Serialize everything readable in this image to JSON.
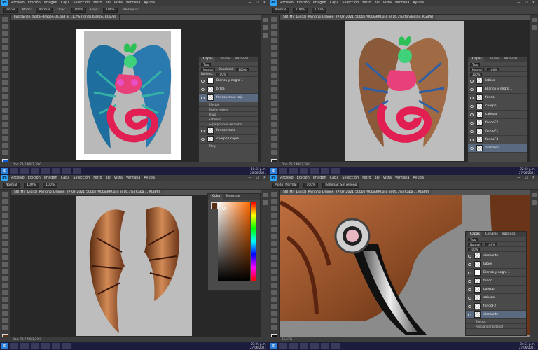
{
  "menu": [
    "Archivo",
    "Edición",
    "Imagen",
    "Capa",
    "Selección",
    "Filtro",
    "3D",
    "Vista",
    "Ventana",
    "Ayuda"
  ],
  "window_controls": [
    "—",
    "☐",
    "✕"
  ],
  "q1": {
    "options": {
      "tool": "Pincel",
      "mode_label": "Modo:",
      "mode": "Normal",
      "opacity_label": "Opac.:",
      "opacity": "100%",
      "flow_label": "Flujo:",
      "flow": "100%",
      "sample_label": "Tolerancia:"
    },
    "tab": "Ilustración digital-dragon-05.psd al 11,2% (fondo blanco, RGB/8)",
    "status": "Doc: 78,7 MB/1,39 G",
    "panel": {
      "tabs": [
        "Capas",
        "Canales",
        "Trazados"
      ],
      "kind": "Tipo",
      "mode": "Normal",
      "opacity_label": "Opacidad:",
      "opacity": "100%",
      "fill_label": "Relleno:",
      "fill": "100%",
      "layers": [
        "Blanco y negro 1",
        "brrza",
        "fondsecmon roja",
        "Efectos",
        "Bisel y relieve",
        "Trazo",
        "Satinado",
        "Superposición de matiz",
        "fondoefecto",
        "cuerpo2 copia",
        "Ttiny"
      ]
    },
    "clock": {
      "time": "10:56 p.m.",
      "date": "26/06/2021"
    }
  },
  "q2": {
    "options": {
      "mode": "Normal",
      "opacity": "100%",
      "flow": "100%"
    },
    "tab": "SIR_Mir_Digital_Painting_Dragon_27-07-2021_5000x7000x300.psd al 16,7% (fondoalas, RGB/8)",
    "status": "Doc: 78,7 MB/1,39 G",
    "panel": {
      "tabs": [
        "Capas",
        "Canales",
        "Trazados"
      ],
      "kind": "Tipo",
      "mode": "Normal",
      "opacity": "100%",
      "fill": "100%",
      "layers": [
        "labios",
        "Blanco y negro 1",
        "fondo",
        "cuerpo",
        "cabeza",
        "fondoF2",
        "fondoF1",
        "fondoF3",
        "fondoF4",
        "alasfinal",
        "alasizquierda"
      ]
    },
    "clock": {
      "time": "02:02 p.m.",
      "date": "27/06/2021"
    }
  },
  "q3": {
    "options": {
      "mode": "Normal",
      "opacity": "100%",
      "flow": "100%"
    },
    "tab": "SIR_Mir_Digital_Painting_Dragon_27-07-2021_5000x7000x300.psd al 16,7% (Capa 1, RGB/8)",
    "status": "Doc: 78,7 MB/1,39 G",
    "panel": {
      "tabs": [
        "Color",
        "Muestras"
      ]
    },
    "clock": {
      "time": "03:26 p.m.",
      "date": "27/06/2021"
    }
  },
  "q4": {
    "options": {
      "mode": "Modo: Normal",
      "opacity": "100%",
      "fill": "Rellenar: Sin relleno"
    },
    "tab": "SIR_Mir_Digital_Painting_Dragon_27-07-2021_5000x7000x300.psd al 66,7% (Capa 1, RGB/8)",
    "status": "66,67%",
    "panel": {
      "tabs": [
        "Capas",
        "Canales",
        "Trazados"
      ],
      "kind": "Tipo",
      "mode": "Normal",
      "opacity": "100%",
      "fill": "100%",
      "layers": [
        "diamante",
        "labios",
        "Blanco y negro 1",
        "fondo",
        "cuerpo",
        "cabeza",
        "fondoF2",
        "diamante",
        "Efectos",
        "Resplandor exterior"
      ]
    },
    "clock": {
      "time": "04:51 p.m.",
      "date": "27/06/2021"
    }
  },
  "colors": {
    "ps_blue": "#31a8ff",
    "app_bg": "#535353",
    "canvas": "#282828",
    "taskbar": "#1c1c3c",
    "selected_layer": "#5a6a80"
  }
}
